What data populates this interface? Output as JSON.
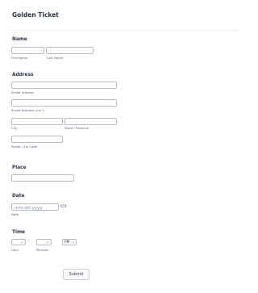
{
  "form": {
    "title": "Golden Ticket"
  },
  "name": {
    "label": "Name",
    "first_sub": "First Name",
    "last_sub": "Last Name"
  },
  "address": {
    "label": "Address",
    "street_sub": "Street Address",
    "street2_sub": "Street Address Line 2",
    "city_sub": "City",
    "state_sub": "State / Province",
    "zip_sub": "Postal / Zip Code"
  },
  "place": {
    "label": "Place"
  },
  "date": {
    "label": "Date",
    "placeholder": "mm-dd-yyyy",
    "sub": "Date"
  },
  "time": {
    "label": "Time",
    "colon": ":",
    "hour_sub": "Hour",
    "minutes_sub": "Minutes",
    "ampm_value": "PM",
    "chevron": "⌄"
  },
  "submit": {
    "label": "Submit"
  },
  "icons": {
    "calendar": "calendar-icon",
    "chevron": "chevron-down-icon"
  }
}
